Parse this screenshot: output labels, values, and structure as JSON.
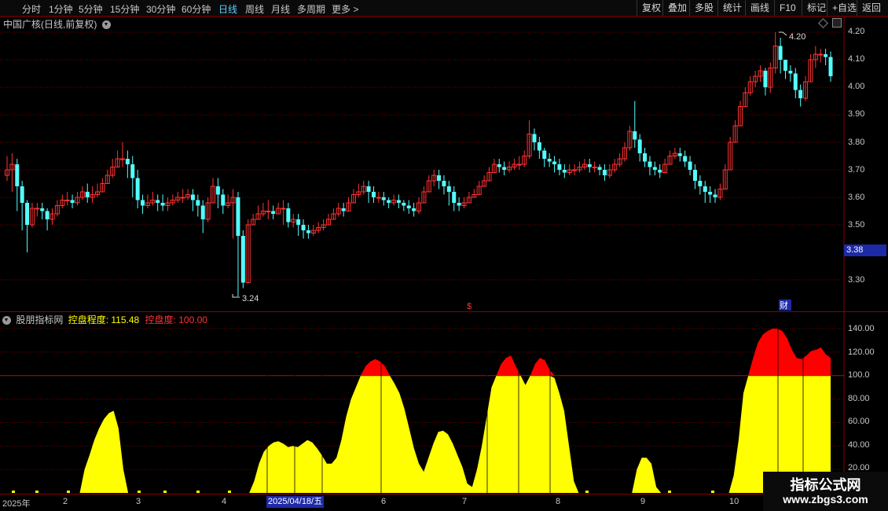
{
  "toolbar": {
    "tabs": [
      "分时",
      "1分钟",
      "5分钟",
      "15分钟",
      "30分钟",
      "60分钟",
      "日线",
      "周线",
      "月线",
      "多周期",
      "更多"
    ],
    "active_tab": "日线",
    "right_buttons": [
      "复权",
      "叠加",
      "多股",
      "统计",
      "画线",
      "F10",
      "标记",
      "+自选",
      "返回"
    ]
  },
  "price_panel": {
    "title": "中国广核(日线,前复权)",
    "axis_labels": [
      "4.20",
      "4.10",
      "4.00",
      "3.90",
      "3.80",
      "3.70",
      "3.60",
      "3.50",
      "3.30"
    ],
    "current_price_tag": "3.38",
    "high_annotation": "4.20",
    "low_annotation": "3.24",
    "marker_s": "$",
    "marker_cai": "财"
  },
  "indicator_panel": {
    "source": "股朋指标网",
    "name_label": "控盘程度:",
    "name_value": "115.48",
    "deg_label": "控盘度:",
    "deg_value": "100.00",
    "axis_labels": [
      "140.00",
      "120.00",
      "100.0",
      "80.00",
      "60.00",
      "40.00",
      "20.00"
    ]
  },
  "xaxis": {
    "labels": [
      "2025年",
      "2",
      "3",
      "4",
      "6",
      "7",
      "8",
      "9",
      "10"
    ],
    "selected_date": "2025/04/18/五"
  },
  "watermark": {
    "line1": "指标公式网",
    "line2": "www.zbgs3.com"
  },
  "colors": {
    "up": "#ff3333",
    "down": "#54ffff",
    "fill": "#ffff00",
    "excess": "#ff0000",
    "grid": "#7a0000",
    "active_tab": "#5fd0ff"
  },
  "chart_data": [
    {
      "type": "candlestick",
      "title": "中国广核(日线,前复权)",
      "ylim": [
        3.2,
        4.24
      ],
      "yticks": [
        3.3,
        3.5,
        3.6,
        3.7,
        3.8,
        3.9,
        4.0,
        4.1,
        4.2
      ],
      "close": [
        3.7,
        3.72,
        3.64,
        3.58,
        3.5,
        3.56,
        3.56,
        3.55,
        3.52,
        3.54,
        3.57,
        3.59,
        3.59,
        3.58,
        3.6,
        3.62,
        3.6,
        3.61,
        3.62,
        3.65,
        3.68,
        3.71,
        3.74,
        3.74,
        3.72,
        3.67,
        3.59,
        3.57,
        3.58,
        3.59,
        3.58,
        3.57,
        3.58,
        3.59,
        3.6,
        3.6,
        3.61,
        3.59,
        3.57,
        3.52,
        3.58,
        3.64,
        3.61,
        3.57,
        3.58,
        3.6,
        3.46,
        3.29,
        3.5,
        3.52,
        3.54,
        3.55,
        3.55,
        3.54,
        3.56,
        3.56,
        3.51,
        3.52,
        3.5,
        3.48,
        3.47,
        3.48,
        3.49,
        3.5,
        3.52,
        3.54,
        3.56,
        3.55,
        3.58,
        3.61,
        3.62,
        3.64,
        3.62,
        3.6,
        3.6,
        3.59,
        3.58,
        3.59,
        3.58,
        3.57,
        3.56,
        3.55,
        3.58,
        3.62,
        3.66,
        3.68,
        3.66,
        3.64,
        3.62,
        3.58,
        3.57,
        3.58,
        3.6,
        3.61,
        3.64,
        3.66,
        3.69,
        3.72,
        3.71,
        3.7,
        3.71,
        3.72,
        3.72,
        3.75,
        3.83,
        3.8,
        3.77,
        3.74,
        3.73,
        3.72,
        3.7,
        3.69,
        3.7,
        3.7,
        3.71,
        3.72,
        3.71,
        3.71,
        3.7,
        3.68,
        3.7,
        3.72,
        3.74,
        3.78,
        3.84,
        3.81,
        3.76,
        3.73,
        3.71,
        3.7,
        3.69,
        3.72,
        3.75,
        3.76,
        3.75,
        3.73,
        3.7,
        3.66,
        3.64,
        3.62,
        3.61,
        3.6,
        3.63,
        3.7,
        3.8,
        3.86,
        3.93,
        3.98,
        4.02,
        4.04,
        4.06,
        4.0,
        4.07,
        4.15,
        4.1,
        4.06,
        4.05,
        3.99,
        3.96,
        4.02,
        4.1,
        4.12,
        4.12,
        4.11,
        4.04
      ],
      "high": [
        3.75,
        3.76,
        3.74,
        3.66,
        3.59,
        3.58,
        3.58,
        3.58,
        3.56,
        3.56,
        3.59,
        3.61,
        3.62,
        3.61,
        3.62,
        3.64,
        3.65,
        3.64,
        3.65,
        3.67,
        3.7,
        3.74,
        3.77,
        3.8,
        3.77,
        3.75,
        3.7,
        3.61,
        3.61,
        3.62,
        3.61,
        3.61,
        3.6,
        3.61,
        3.62,
        3.63,
        3.63,
        3.63,
        3.61,
        3.59,
        3.6,
        3.67,
        3.67,
        3.63,
        3.61,
        3.63,
        3.62,
        3.48,
        3.52,
        3.54,
        3.57,
        3.58,
        3.59,
        3.57,
        3.58,
        3.59,
        3.58,
        3.54,
        3.54,
        3.52,
        3.5,
        3.5,
        3.51,
        3.52,
        3.54,
        3.56,
        3.58,
        3.58,
        3.6,
        3.63,
        3.65,
        3.66,
        3.66,
        3.64,
        3.62,
        3.62,
        3.6,
        3.61,
        3.61,
        3.59,
        3.59,
        3.58,
        3.6,
        3.64,
        3.68,
        3.7,
        3.7,
        3.68,
        3.66,
        3.64,
        3.6,
        3.6,
        3.62,
        3.63,
        3.66,
        3.68,
        3.71,
        3.74,
        3.74,
        3.73,
        3.73,
        3.74,
        3.75,
        3.77,
        3.88,
        3.85,
        3.82,
        3.78,
        3.76,
        3.75,
        3.74,
        3.72,
        3.72,
        3.72,
        3.73,
        3.74,
        3.74,
        3.73,
        3.72,
        3.72,
        3.72,
        3.74,
        3.76,
        3.8,
        3.86,
        3.95,
        3.83,
        3.78,
        3.75,
        3.73,
        3.72,
        3.74,
        3.77,
        3.78,
        3.78,
        3.77,
        3.75,
        3.72,
        3.68,
        3.66,
        3.64,
        3.63,
        3.65,
        3.72,
        3.82,
        3.88,
        3.95,
        4.0,
        4.04,
        4.06,
        4.08,
        4.07,
        4.09,
        4.2,
        4.18,
        4.1,
        4.08,
        4.07,
        4.01,
        4.04,
        4.12,
        4.15,
        4.14,
        4.14,
        4.13
      ],
      "low": [
        3.66,
        3.62,
        3.55,
        3.48,
        3.4,
        3.49,
        3.53,
        3.52,
        3.48,
        3.5,
        3.53,
        3.56,
        3.57,
        3.56,
        3.57,
        3.59,
        3.58,
        3.58,
        3.6,
        3.62,
        3.65,
        3.67,
        3.71,
        3.71,
        3.67,
        3.6,
        3.56,
        3.54,
        3.56,
        3.57,
        3.55,
        3.55,
        3.55,
        3.57,
        3.58,
        3.58,
        3.59,
        3.55,
        3.53,
        3.47,
        3.51,
        3.58,
        3.56,
        3.54,
        3.56,
        3.45,
        3.24,
        3.27,
        3.48,
        3.5,
        3.52,
        3.53,
        3.52,
        3.52,
        3.54,
        3.5,
        3.49,
        3.49,
        3.46,
        3.45,
        3.45,
        3.46,
        3.47,
        3.48,
        3.5,
        3.52,
        3.53,
        3.53,
        3.55,
        3.58,
        3.6,
        3.61,
        3.58,
        3.58,
        3.58,
        3.57,
        3.56,
        3.57,
        3.56,
        3.55,
        3.54,
        3.53,
        3.54,
        3.58,
        3.62,
        3.64,
        3.63,
        3.61,
        3.57,
        3.55,
        3.55,
        3.56,
        3.58,
        3.6,
        3.62,
        3.64,
        3.67,
        3.7,
        3.69,
        3.68,
        3.69,
        3.7,
        3.7,
        3.71,
        3.74,
        3.77,
        3.74,
        3.71,
        3.71,
        3.69,
        3.68,
        3.67,
        3.68,
        3.68,
        3.69,
        3.7,
        3.69,
        3.69,
        3.68,
        3.66,
        3.67,
        3.69,
        3.71,
        3.73,
        3.77,
        3.78,
        3.73,
        3.71,
        3.68,
        3.68,
        3.67,
        3.69,
        3.72,
        3.74,
        3.73,
        3.71,
        3.68,
        3.63,
        3.61,
        3.58,
        3.58,
        3.58,
        3.59,
        3.64,
        3.73,
        3.81,
        3.86,
        3.93,
        3.97,
        4.0,
        4.02,
        3.97,
        3.98,
        4.05,
        4.05,
        4.03,
        4.02,
        3.96,
        3.93,
        3.95,
        4.02,
        4.07,
        4.09,
        4.08,
        4.02
      ]
    },
    {
      "type": "area",
      "series": [
        {
          "name": "控盘程度",
          "values": [
            0,
            0,
            0,
            0,
            0,
            0,
            0,
            0,
            0,
            0,
            0,
            0,
            0,
            0,
            0,
            0,
            20,
            32,
            45,
            55,
            63,
            68,
            70,
            55,
            20,
            0,
            0,
            0,
            0,
            0,
            0,
            0,
            0,
            0,
            0,
            0,
            0,
            0,
            0,
            0,
            0,
            0,
            0,
            0,
            0,
            0,
            0,
            0,
            0,
            0,
            0,
            10,
            25,
            35,
            40,
            43,
            44,
            42,
            39,
            40,
            39,
            42,
            45,
            43,
            38,
            32,
            25,
            25,
            30,
            45,
            65,
            80,
            90,
            100,
            108,
            112,
            114,
            112,
            108,
            100,
            93,
            85,
            72,
            55,
            38,
            25,
            18,
            30,
            42,
            52,
            53,
            50,
            42,
            32,
            22,
            8,
            5,
            20,
            40,
            65,
            90,
            100,
            110,
            115,
            117,
            108,
            100,
            92,
            100,
            110,
            115,
            113,
            105,
            98,
            85,
            70,
            40,
            10,
            0,
            0,
            0,
            0,
            0,
            0,
            0,
            0,
            0,
            0,
            0,
            0,
            20,
            30,
            30,
            25,
            5,
            0,
            0,
            0,
            0,
            0,
            0,
            0,
            0,
            0,
            0,
            0,
            0,
            0,
            0,
            0,
            15,
            45,
            85,
            100,
            115,
            128,
            135,
            138,
            140,
            140,
            138,
            132,
            122,
            115,
            114,
            117,
            121,
            122,
            124,
            118,
            115
          ]
        }
      ],
      "ylim": [
        0,
        145
      ],
      "threshold": 100,
      "yticks": [
        20,
        40,
        60,
        80,
        100,
        120,
        140
      ]
    }
  ]
}
